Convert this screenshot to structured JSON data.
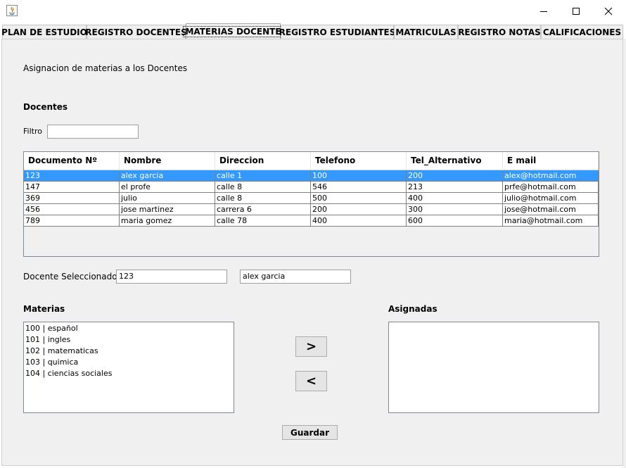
{
  "window": {
    "icon": "java-icon"
  },
  "tabs": [
    {
      "label": "PLAN DE ESTUDIO",
      "active": false
    },
    {
      "label": "REGISTRO DOCENTES",
      "active": false
    },
    {
      "label": "MATERIAS DOCENTE",
      "active": true
    },
    {
      "label": "REGISTRO ESTUDIANTES",
      "active": false
    },
    {
      "label": "MATRICULAS",
      "active": false
    },
    {
      "label": "REGISTRO NOTAS",
      "active": false
    },
    {
      "label": "CALIFICACIONES",
      "active": false
    }
  ],
  "page": {
    "heading": "Asignacion de materias a los Docentes",
    "docentes_title": "Docentes",
    "filter_label": "Filtro",
    "filter_value": ""
  },
  "table": {
    "columns": [
      "Documento Nº",
      "Nombre",
      "Direccion",
      "Telefono",
      "Tel_Alternativo",
      "E mail"
    ],
    "rows": [
      [
        "123",
        "alex garcia",
        "calle 1",
        "100",
        "200",
        "alex@hotmail.com"
      ],
      [
        "147",
        "el profe",
        "calle 8",
        "546",
        "213",
        "prfe@hotmail.com"
      ],
      [
        "369",
        "julio",
        "calle 8",
        "500",
        "400",
        "julio@hotmail.com"
      ],
      [
        "456",
        "jose martinez",
        "carrera 6",
        "200",
        "300",
        "jose@hotmail.com"
      ],
      [
        "789",
        "maria gomez",
        "calle 78",
        "400",
        "600",
        "maria@hotmail.com"
      ]
    ],
    "selected_row": 0
  },
  "selected": {
    "label": "Docente Seleccionado",
    "id": "123",
    "name": "alex garcia"
  },
  "materias": {
    "title": "Materias",
    "items": [
      "100 | español",
      "101 | ingles",
      "102 | matematicas",
      "103 | quimica",
      "104 | ciencias sociales"
    ]
  },
  "asignadas": {
    "title": "Asignadas",
    "items": []
  },
  "buttons": {
    "add": ">",
    "remove": "<",
    "save": "Guardar"
  },
  "colors": {
    "selection": "#3399ff",
    "panel": "#f0f0f0"
  }
}
